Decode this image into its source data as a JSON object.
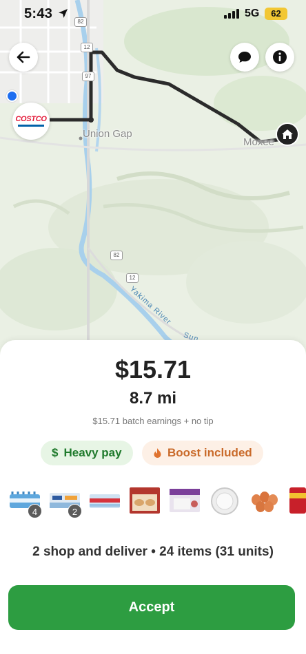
{
  "status_bar": {
    "time": "5:43",
    "network": "5G",
    "battery": "62",
    "icons": [
      "location-arrow-icon",
      "signal-bars-icon",
      "battery-icon"
    ]
  },
  "map": {
    "labels": {
      "union_gap": "Union Gap",
      "moxee": "Moxee",
      "river": "Yakima River",
      "river_partial": "Sun"
    },
    "highway_shields": [
      "82",
      "12",
      "97",
      "82",
      "12"
    ],
    "store_marker": {
      "brand": "COSTCO",
      "brand_color": "#e31837"
    },
    "route_color": "#2b2b2b",
    "user_dot_color": "#1e6ef0",
    "buttons": [
      "back-icon",
      "chat-icon",
      "info-icon"
    ]
  },
  "order": {
    "pay": "$15.71",
    "distance": "8.7 mi",
    "earnings_note": "$15.71 batch earnings + no tip",
    "badges": {
      "heavy": {
        "icon": "$",
        "label": "Heavy pay",
        "color": "#1f7a2c"
      },
      "boost": {
        "icon": "flame-icon",
        "label": "Boost included",
        "color": "#c96a2a"
      }
    },
    "item_quantities": [
      "4",
      "2"
    ],
    "summary": "2 shop and deliver • 24 items (31 units)",
    "accept_label": "Accept",
    "accept_color": "#2d9d41"
  }
}
